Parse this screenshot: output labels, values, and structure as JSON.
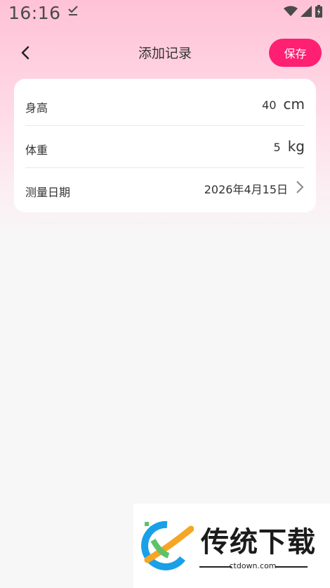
{
  "status_bar": {
    "time": "16:16"
  },
  "header": {
    "title": "添加记录",
    "save_label": "保存"
  },
  "form": {
    "height": {
      "label": "身高",
      "value": "40",
      "unit": "cm"
    },
    "weight": {
      "label": "体重",
      "value": "5",
      "unit": "kg"
    },
    "date": {
      "label": "测量日期",
      "value": "2026年4月15日"
    }
  },
  "watermark": {
    "title": "传统下载",
    "subtitle": "ctdown.com"
  },
  "colors": {
    "accent": "#ff1f73"
  }
}
